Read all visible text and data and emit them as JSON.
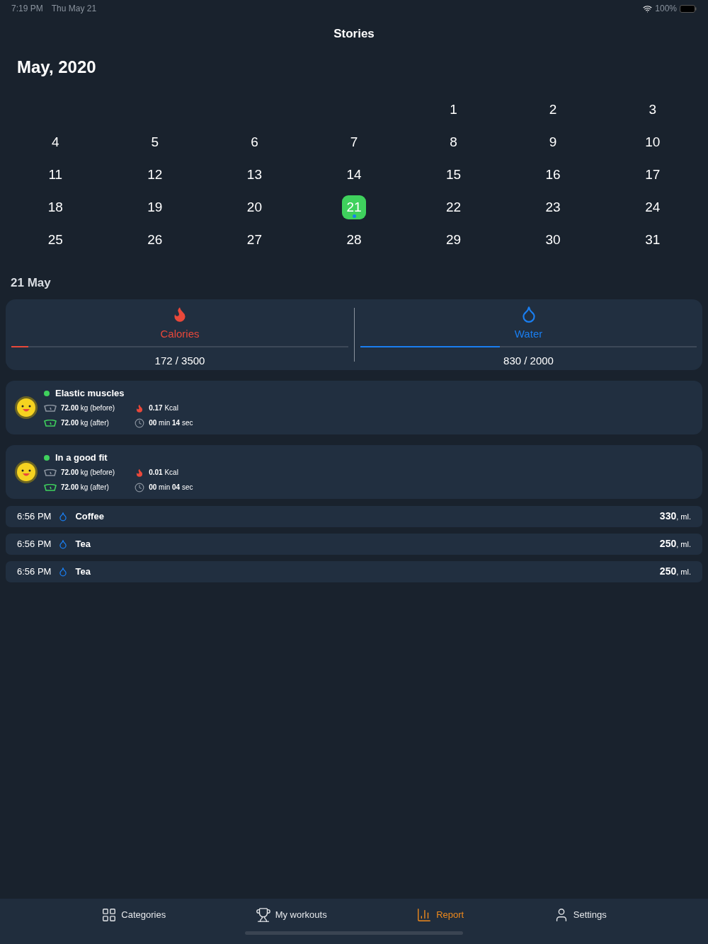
{
  "status_bar": {
    "time": "7:19 PM",
    "date": "Thu May 21",
    "battery": "100%"
  },
  "title": "Stories",
  "month": "May, 2020",
  "calendar": {
    "weeks": [
      {
        "days": [
          {
            "label": "1",
            "selected": false,
            "marked": false
          },
          {
            "label": "2",
            "selected": false,
            "marked": false
          },
          {
            "label": "3",
            "selected": false,
            "marked": false
          }
        ]
      },
      {
        "days": [
          {
            "label": "4",
            "selected": false,
            "marked": false
          },
          {
            "label": "5",
            "selected": false,
            "marked": false
          },
          {
            "label": "6",
            "selected": false,
            "marked": false
          },
          {
            "label": "7",
            "selected": false,
            "marked": false
          },
          {
            "label": "8",
            "selected": false,
            "marked": false
          },
          {
            "label": "9",
            "selected": false,
            "marked": false
          },
          {
            "label": "10",
            "selected": false,
            "marked": false
          }
        ]
      },
      {
        "days": [
          {
            "label": "11",
            "selected": false,
            "marked": false
          },
          {
            "label": "12",
            "selected": false,
            "marked": false
          },
          {
            "label": "13",
            "selected": false,
            "marked": false
          },
          {
            "label": "14",
            "selected": false,
            "marked": false
          },
          {
            "label": "15",
            "selected": false,
            "marked": false
          },
          {
            "label": "16",
            "selected": false,
            "marked": false
          },
          {
            "label": "17",
            "selected": false,
            "marked": false
          }
        ]
      },
      {
        "days": [
          {
            "label": "18",
            "selected": false,
            "marked": false
          },
          {
            "label": "19",
            "selected": false,
            "marked": false
          },
          {
            "label": "20",
            "selected": false,
            "marked": false
          },
          {
            "label": "21",
            "selected": true,
            "marked": true
          },
          {
            "label": "22",
            "selected": false,
            "marked": false
          },
          {
            "label": "23",
            "selected": false,
            "marked": false
          },
          {
            "label": "24",
            "selected": false,
            "marked": false
          }
        ]
      },
      {
        "days": [
          {
            "label": "25",
            "selected": false,
            "marked": false
          },
          {
            "label": "26",
            "selected": false,
            "marked": false
          },
          {
            "label": "27",
            "selected": false,
            "marked": false
          },
          {
            "label": "28",
            "selected": false,
            "marked": false
          },
          {
            "label": "29",
            "selected": false,
            "marked": false
          },
          {
            "label": "30",
            "selected": false,
            "marked": false
          },
          {
            "label": "31",
            "selected": false,
            "marked": false
          }
        ]
      }
    ]
  },
  "day_title": "21 May",
  "summary": [
    {
      "kind": "calories",
      "label": "Calories",
      "level": 0.05,
      "reading": "172 / 3500"
    },
    {
      "kind": "water",
      "label": "Water",
      "level": 0.415,
      "reading": "830 / 2000"
    }
  ],
  "workouts": [
    {
      "name": "Elastic muscles",
      "color": "#3fd15d",
      "weight_before": "72.00",
      "before_unit": "kg (before)",
      "weight_after": "72.00",
      "after_unit": "kg (after)",
      "kcal": "0.17",
      "kcal_unit": "Kcal",
      "minutes": "00",
      "min_unit": "min",
      "seconds": "14",
      "sec_unit": "sec"
    },
    {
      "name": "In a good fit",
      "color": "#3fd15d",
      "weight_before": "72.00",
      "before_unit": "kg (before)",
      "weight_after": "72.00",
      "after_unit": "kg (after)",
      "kcal": "0.01",
      "kcal_unit": "Kcal",
      "minutes": "00",
      "min_unit": "min",
      "seconds": "04",
      "sec_unit": "sec"
    }
  ],
  "drinks": [
    {
      "time": "6:56 PM",
      "name": "Coffee",
      "amount": "330",
      "unit": ", ml."
    },
    {
      "time": "6:56 PM",
      "name": "Tea",
      "amount": "250",
      "unit": ", ml."
    },
    {
      "time": "6:56 PM",
      "name": "Tea",
      "amount": "250",
      "unit": ", ml."
    }
  ],
  "tabs": [
    {
      "kind": "categories",
      "label": "Categories",
      "selected": false
    },
    {
      "kind": "workouts",
      "label": "My workouts",
      "selected": false
    },
    {
      "kind": "report",
      "label": "Report",
      "selected": true
    },
    {
      "kind": "settings",
      "label": "Settings",
      "selected": false
    }
  ]
}
